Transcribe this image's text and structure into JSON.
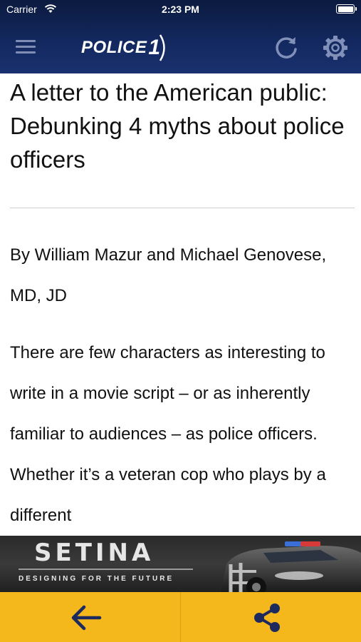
{
  "status_bar": {
    "carrier": "Carrier",
    "time": "2:23 PM",
    "wifi_icon": "wifi-icon",
    "battery_icon": "battery-icon"
  },
  "nav": {
    "logo_text": "POLICE",
    "logo_number": "1",
    "menu_icon": "hamburger-menu-icon",
    "refresh_icon": "refresh-icon",
    "settings_icon": "gear-icon",
    "background_color": "#13285e"
  },
  "article": {
    "headline": "A letter to the American public: Debunking 4 myths about police officers",
    "byline": "By William Mazur and Michael Genovese, MD, JD",
    "body": "There are few characters as interesting to write in a movie script – or as inherently familiar to audiences – as police officers. Whether it’s a veteran cop who plays by a different"
  },
  "ad": {
    "brand": "SETINA",
    "tagline": "DESIGNING FOR THE FUTURE"
  },
  "toolbar": {
    "back_icon": "arrow-left-icon",
    "share_icon": "share-icon",
    "background_color": "#f5b81c"
  }
}
